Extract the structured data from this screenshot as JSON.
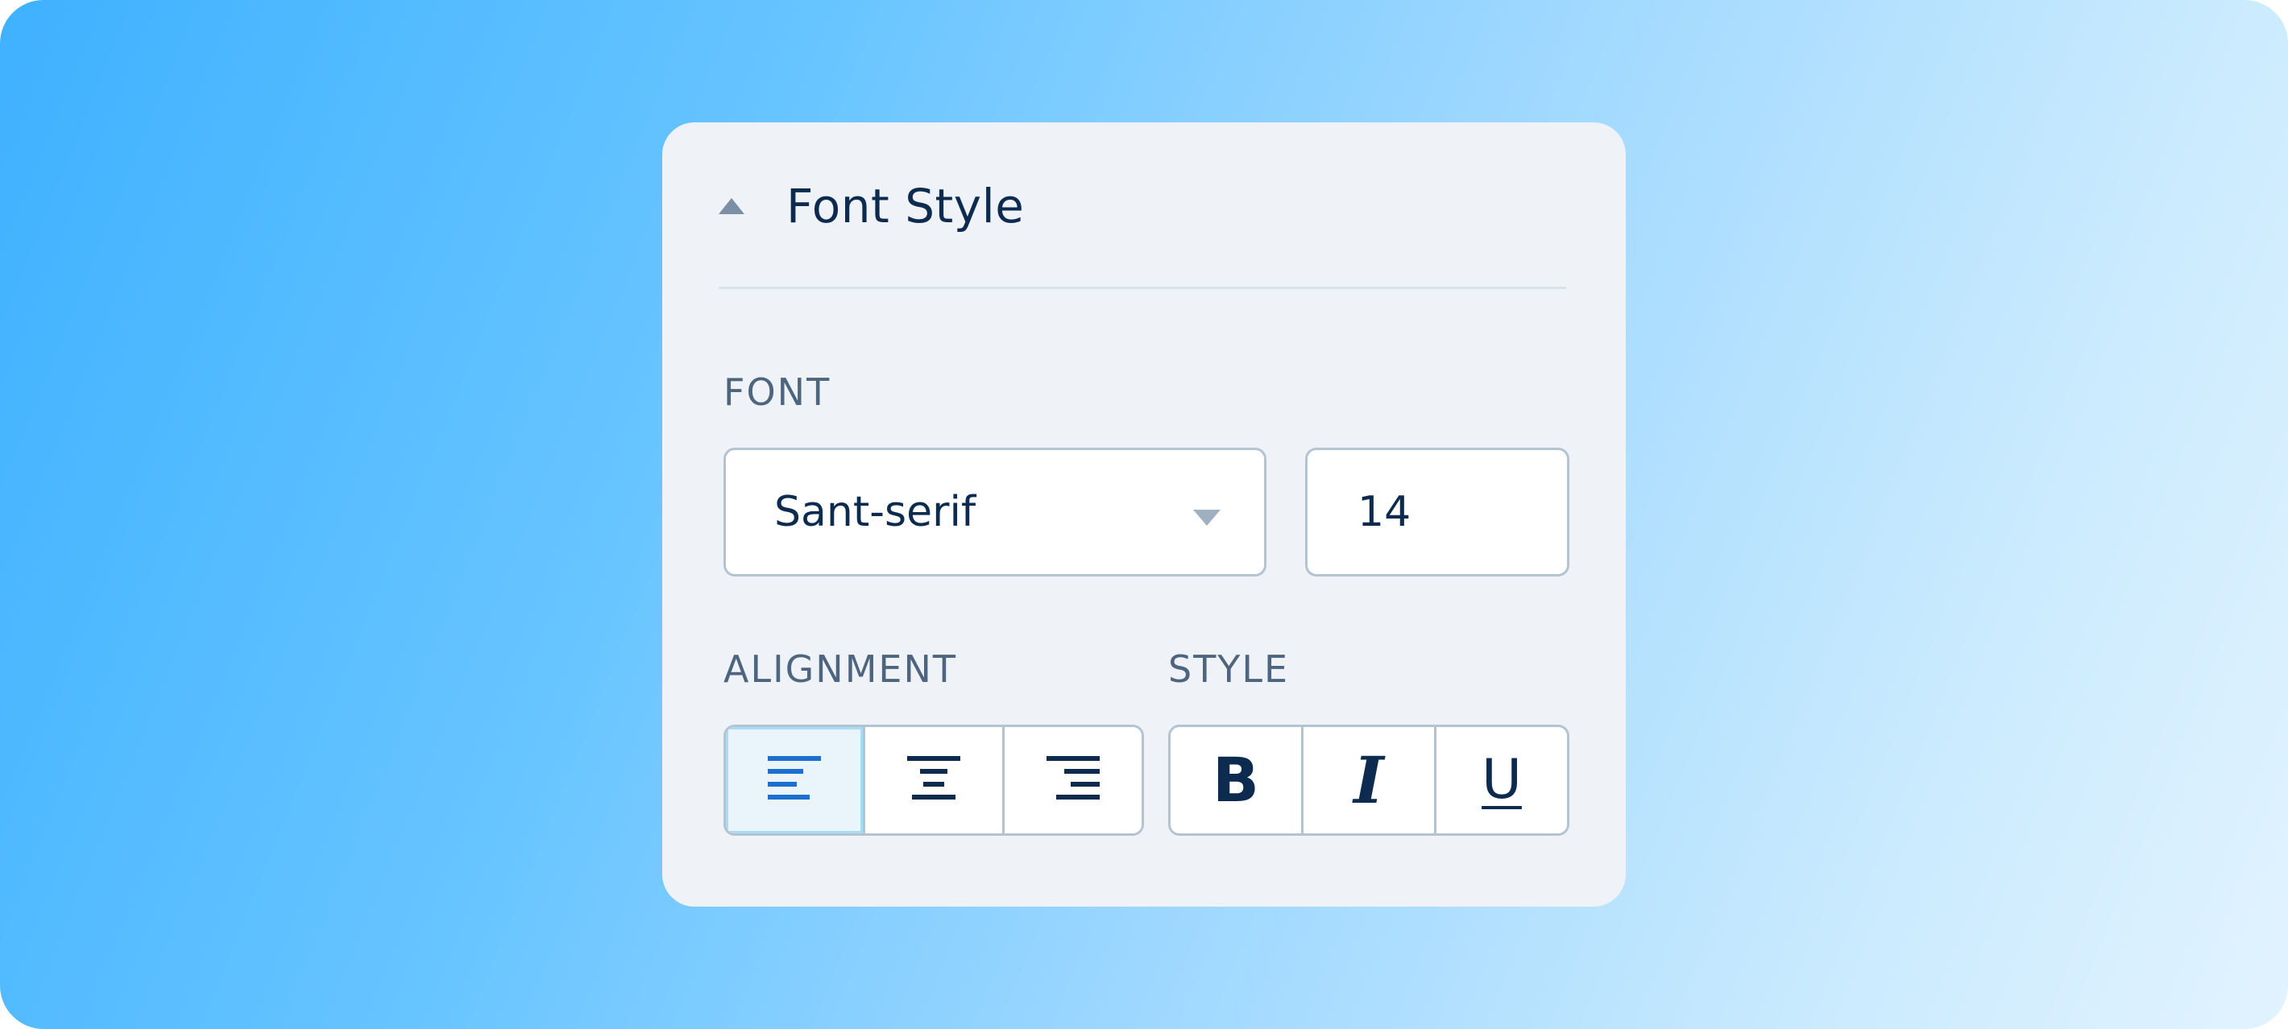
{
  "panel": {
    "title": "Font Style",
    "collapse_icon": "caret-up-icon"
  },
  "font": {
    "label": "FONT",
    "family_value": "Sant-serif",
    "dropdown_icon": "caret-down-icon",
    "size_value": "14"
  },
  "alignment": {
    "label": "ALIGNMENT",
    "options": [
      {
        "icon": "align-left-icon",
        "selected": true
      },
      {
        "icon": "align-center-icon",
        "selected": false
      },
      {
        "icon": "align-right-icon",
        "selected": false
      }
    ]
  },
  "style": {
    "label": "STYLE",
    "bold_label": "B",
    "italic_label": "I",
    "underline_label": "U"
  },
  "colors": {
    "accent": "#1a6fd1",
    "text": "#0d2b4e",
    "label": "#4e6580",
    "border": "#b4c3d0",
    "active_bg": "#e9f4fb"
  }
}
